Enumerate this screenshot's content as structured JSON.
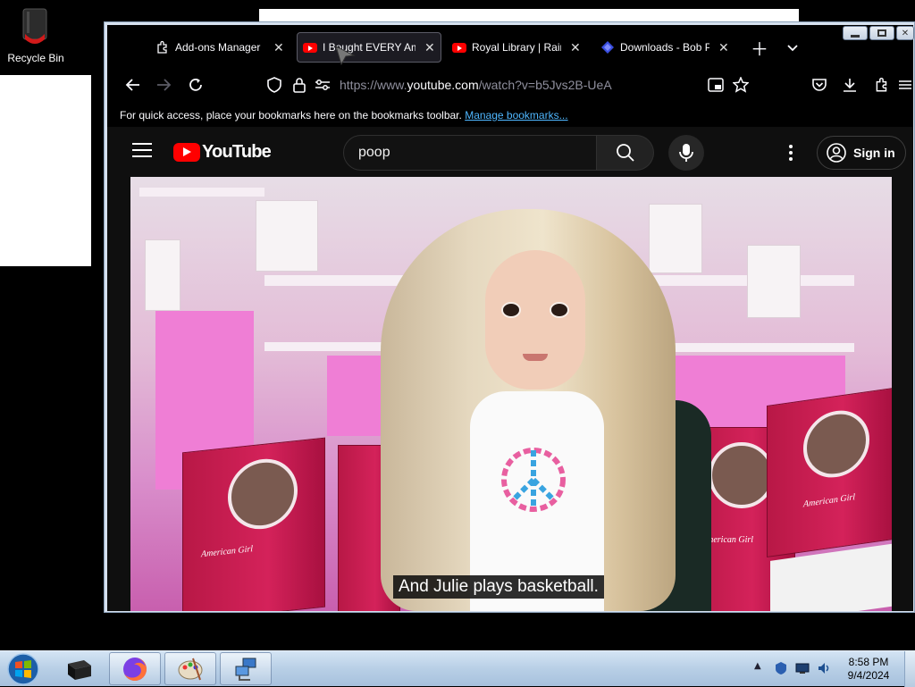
{
  "desktop": {
    "recycle_bin_label": "Recycle Bin"
  },
  "browser": {
    "tabs": [
      {
        "label": "Add-ons Manager",
        "icon": "puzzle-icon",
        "active": false
      },
      {
        "label": "I Bought EVERY Am",
        "icon": "youtube-icon",
        "active": true
      },
      {
        "label": "Royal Library | Rain",
        "icon": "youtube-icon",
        "active": false
      },
      {
        "label": "Downloads - Bob Po",
        "icon": "downloads-icon",
        "active": false
      }
    ],
    "url": {
      "prefix": "https://www.",
      "host": "youtube.com",
      "path": "/watch?v=b5Jvs2B-UeA"
    },
    "bookmarks_bar": {
      "message": "For quick access, place your bookmarks here on the bookmarks toolbar.",
      "link": "Manage bookmarks..."
    }
  },
  "youtube": {
    "logo_text": "YouTube",
    "search_value": "poop",
    "sign_in_label": "Sign in",
    "video_caption": "And Julie plays basketball.",
    "box_brand": "American Girl"
  },
  "taskbar": {
    "time": "8:58 PM",
    "date": "9/4/2024"
  },
  "colors": {
    "youtube_red": "#ff0000",
    "link_blue": "#4fb7ff",
    "box_red": "#c81e50"
  }
}
